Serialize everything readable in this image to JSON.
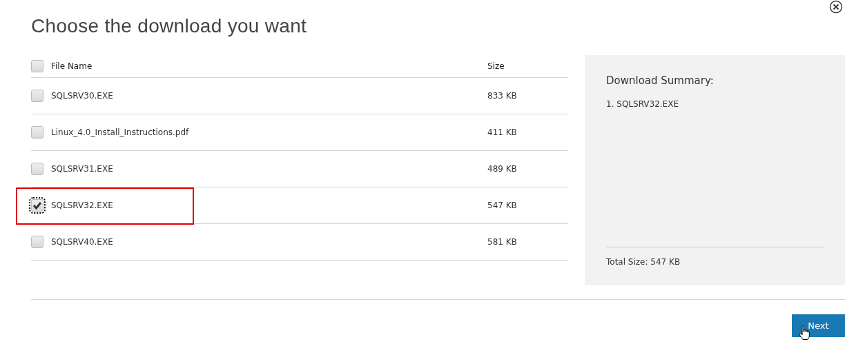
{
  "title": "Choose the download you want",
  "table": {
    "select_all": {
      "checked": false
    },
    "columns": [
      "File Name",
      "Size"
    ],
    "rows": [
      {
        "name": "SQLSRV30.EXE",
        "size": "833 KB",
        "checked": false,
        "focused": false,
        "highlighted": false
      },
      {
        "name": "Linux_4.0_Install_Instructions.pdf",
        "size": "411 KB",
        "checked": false,
        "focused": false,
        "highlighted": false
      },
      {
        "name": "SQLSRV31.EXE",
        "size": "489 KB",
        "checked": false,
        "focused": false,
        "highlighted": false
      },
      {
        "name": "SQLSRV32.EXE",
        "size": "547 KB",
        "checked": true,
        "focused": true,
        "highlighted": true
      },
      {
        "name": "SQLSRV40.EXE",
        "size": "581 KB",
        "checked": false,
        "focused": false,
        "highlighted": false
      }
    ]
  },
  "summary": {
    "heading": "Download Summary:",
    "items": [
      "1. SQLSRV32.EXE"
    ],
    "total": "Total Size: 547 KB"
  },
  "next_button": "Next"
}
